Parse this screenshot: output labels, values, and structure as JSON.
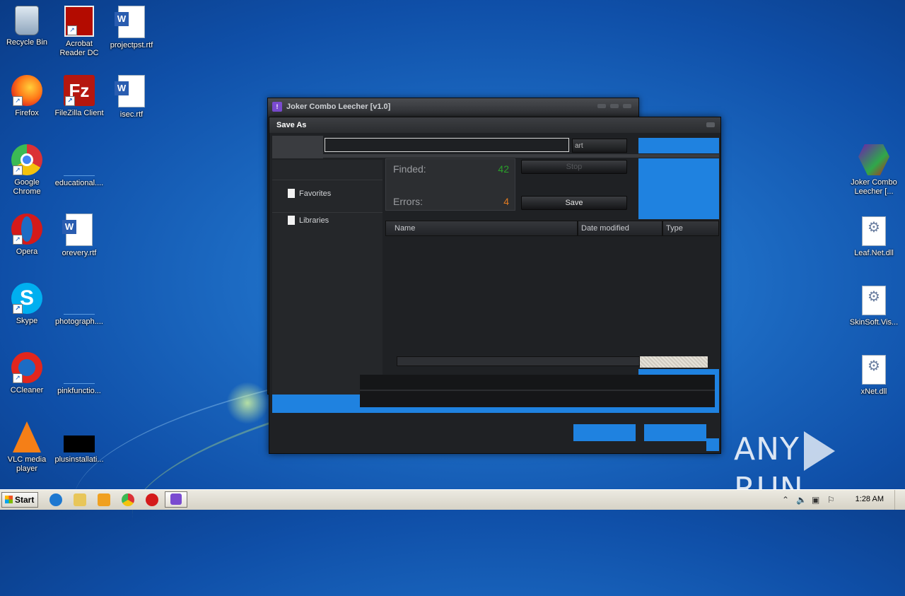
{
  "desktop": {
    "icons_left": [
      {
        "label": "Recycle Bin",
        "icon": "recycle-bin-icon"
      },
      {
        "label": "Acrobat Reader DC",
        "icon": "acrobat-icon"
      },
      {
        "label": "projectpst.rtf",
        "icon": "word-doc-icon"
      },
      {
        "label": "Firefox",
        "icon": "firefox-icon"
      },
      {
        "label": "FileZilla Client",
        "icon": "filezilla-icon"
      },
      {
        "label": "isec.rtf",
        "icon": "word-doc-icon"
      },
      {
        "label": "Google Chrome",
        "icon": "chrome-icon"
      },
      {
        "label": "educational....",
        "icon": "blank-file-icon"
      },
      {
        "label": "Opera",
        "icon": "opera-icon"
      },
      {
        "label": "orevery.rtf",
        "icon": "word-doc-icon"
      },
      {
        "label": "Skype",
        "icon": "skype-icon"
      },
      {
        "label": "photograph....",
        "icon": "blank-file-icon"
      },
      {
        "label": "CCleaner",
        "icon": "ccleaner-icon"
      },
      {
        "label": "pinkfunctio...",
        "icon": "blank-file-icon"
      },
      {
        "label": "VLC media player",
        "icon": "vlc-icon"
      },
      {
        "label": "plusinstallati...",
        "icon": "black-file-icon"
      }
    ],
    "icons_right": [
      {
        "label": "Joker Combo Leecher [...",
        "icon": "joker-icon"
      },
      {
        "label": "Leaf.Net.dll",
        "icon": "dll-file-icon"
      },
      {
        "label": "SkinSoft.Vis...",
        "icon": "dll-file-icon"
      },
      {
        "label": "xNet.dll",
        "icon": "dll-file-icon"
      }
    ],
    "watermark": "ANY",
    "watermark2": "RUN"
  },
  "joker_window": {
    "title": "Joker Combo Leecher [v1.0]"
  },
  "save_dialog": {
    "title": "Save As",
    "search_btn": "art",
    "nav": {
      "favorites": "Favorites",
      "libraries": "Libraries"
    },
    "stats": {
      "finded_label": "Finded:",
      "finded_value": "42",
      "errors_label": "Errors:",
      "errors_value": "4"
    },
    "buttons": {
      "stop": "Stop",
      "save": "Save"
    },
    "columns": [
      "Name",
      "Date modified",
      "Type"
    ],
    "colors": {
      "accent": "#1f82e0",
      "finded": "#2aa02a",
      "errors": "#e07a20"
    }
  },
  "taskbar": {
    "start_label": "Start",
    "clock": "1:28 AM"
  }
}
